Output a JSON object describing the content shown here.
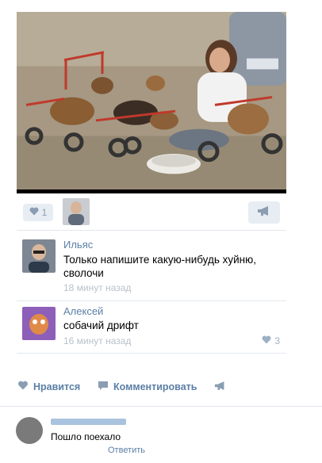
{
  "post": {
    "likes_count": "1"
  },
  "comments": [
    {
      "author": "Ильяс",
      "text": "Только напишите какую-нибудь хуйню, сволочи",
      "time": "18 минут назад",
      "likes": ""
    },
    {
      "author": "Алексей",
      "text": "собачий дрифт",
      "time": "16 минут назад",
      "likes": "3"
    }
  ],
  "actions": {
    "like_label": "Нравится",
    "comment_label": "Комментировать"
  },
  "reply": {
    "text": "Пошло поехало",
    "reply_label": "Ответить"
  },
  "colors": {
    "link": "#5b7fa6",
    "icon": "#8a9db3",
    "pill_bg": "#e7edf3"
  },
  "icons": {
    "like": "heart-icon",
    "comment": "comment-icon",
    "share": "megaphone-icon"
  }
}
